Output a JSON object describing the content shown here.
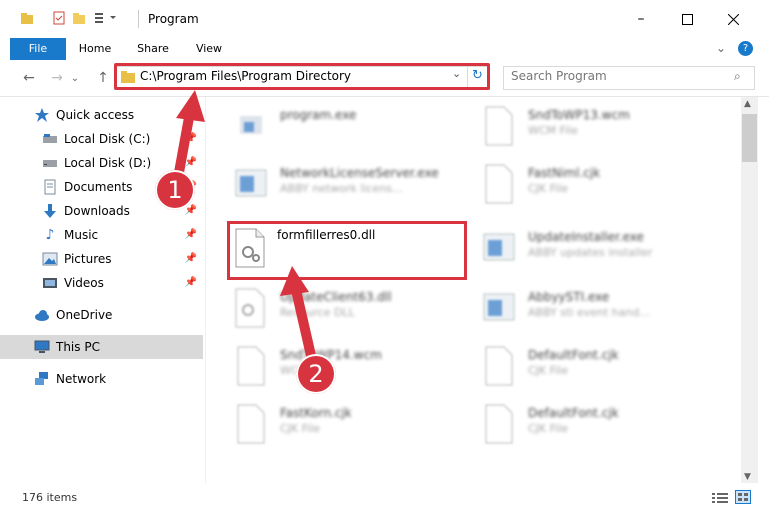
{
  "window": {
    "title": "Program"
  },
  "ribbon": {
    "file": "File",
    "home": "Home",
    "share": "Share",
    "view": "View"
  },
  "address": {
    "path": "C:\\Program Files\\Program Directory"
  },
  "search": {
    "placeholder": "Search Program"
  },
  "sidebar": {
    "items": [
      {
        "label": "Quick access",
        "icon": "star-icon"
      },
      {
        "label": "Local Disk (C:)",
        "icon": "drive-icon",
        "pinned": true
      },
      {
        "label": "Local Disk (D:)",
        "icon": "drive-icon",
        "pinned": true
      },
      {
        "label": "Documents",
        "icon": "document-icon",
        "pinned": true
      },
      {
        "label": "Downloads",
        "icon": "download-icon",
        "pinned": true
      },
      {
        "label": "Music",
        "icon": "music-icon",
        "pinned": true
      },
      {
        "label": "Pictures",
        "icon": "picture-icon",
        "pinned": true
      },
      {
        "label": "Videos",
        "icon": "video-icon",
        "pinned": true
      },
      {
        "label": "OneDrive",
        "icon": "cloud-icon"
      },
      {
        "label": "This PC",
        "icon": "computer-icon",
        "selected": true
      },
      {
        "label": "Network",
        "icon": "network-icon"
      }
    ]
  },
  "files": {
    "col1": [
      {
        "name": "program.exe",
        "sub": ""
      },
      {
        "name": "NetworkLicenseServer.exe",
        "sub": "ABBY network licens..."
      },
      {
        "name": "formfillerres0.dll",
        "sub": ""
      },
      {
        "name": "UpdateClient63.dll",
        "sub": "Resource DLL"
      },
      {
        "name": "SndToWP14.wcm",
        "sub": "WCM File"
      },
      {
        "name": "FastKorn.cjk",
        "sub": "CJK File"
      }
    ],
    "col2": [
      {
        "name": "SndToWP13.wcm",
        "sub": "WCM File"
      },
      {
        "name": "FastNiml.cjk",
        "sub": "CJK File"
      },
      {
        "name": "UpdateInstaller.exe",
        "sub": "ABBY updates installer"
      },
      {
        "name": "AbbyySTI.exe",
        "sub": "ABBY sti event hand..."
      },
      {
        "name": "DefaultFont.cjk",
        "sub": "CJK File"
      },
      {
        "name": "DefaultFont.cjk",
        "sub": "CJK File"
      }
    ]
  },
  "status": {
    "count": "176 items"
  },
  "callouts": {
    "one": "1",
    "two": "2"
  },
  "colors": {
    "accent": "#1979ca",
    "highlight": "#d8343f"
  }
}
